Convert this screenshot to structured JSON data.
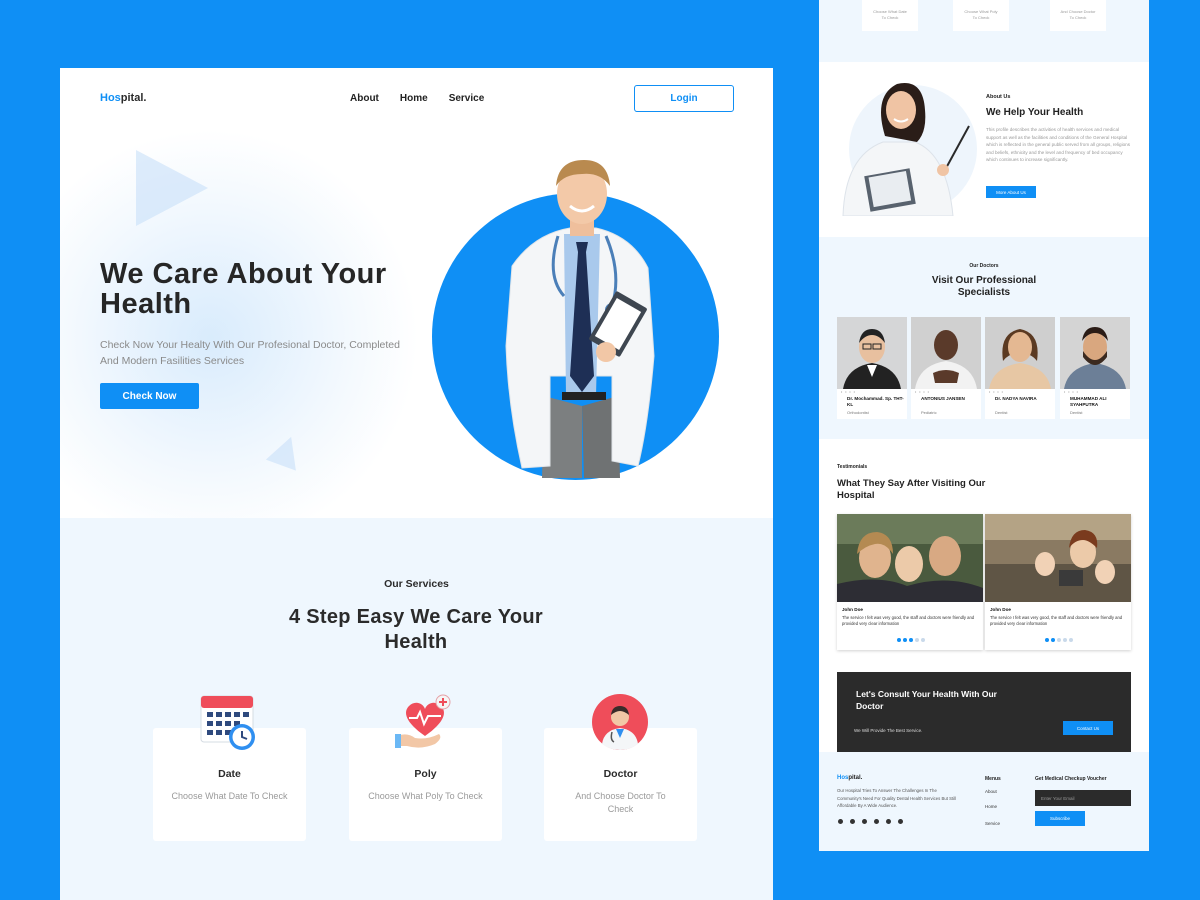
{
  "main": {
    "logo": {
      "prefix": "Hos",
      "suffix": "pital."
    },
    "nav": {
      "about": "About",
      "home": "Home",
      "service": "Service",
      "login": "Login"
    },
    "hero": {
      "title": "We Care About Your Health",
      "subtitle": "Check Now Your Healty With Our Profesional Doctor, Completed And Modern Fasilities Services",
      "button": "Check Now"
    },
    "services": {
      "kicker": "Our Services",
      "title": "4 Step Easy We Care Your Health",
      "cards": [
        {
          "title": "Date",
          "text": "Choose What Date To Check",
          "icon": "calendar-clock-icon"
        },
        {
          "title": "Poly",
          "text": "Choose What Poly To Check",
          "icon": "heart-hand-icon"
        },
        {
          "title": "Doctor",
          "text": "And Choose Doctor To Check",
          "icon": "doctor-avatar-icon"
        }
      ]
    }
  },
  "side": {
    "top_cards": [
      {
        "line1": "Choose What Date",
        "line2": "To Check"
      },
      {
        "line1": "Choose What Poly",
        "line2": "To Check"
      },
      {
        "line1": "And Choose Doctor",
        "line2": "To Check"
      }
    ],
    "about": {
      "kicker": "About Us",
      "title": "We Help Your Health",
      "text": "This profile describes the activities of health services and medical support as well as the facilities and conditions of the General Hospital which is reflected in the general public served from all groups, religions and beliefs, ethnicity and the level and frequency of bed occupancy which continues to increase significantly.",
      "button": "More About Us"
    },
    "specialists": {
      "kicker": "Our Doctors",
      "title": "Visit Our Professional Specialists",
      "doctors": [
        {
          "name": "Dr. Mochammad. Sp. THT-KL",
          "role": "Orthodontist"
        },
        {
          "name": "ANTONIUS JANSEN",
          "role": "Pediatric"
        },
        {
          "name": "Dr. NADYA NAVIRA",
          "role": "Dentist"
        },
        {
          "name": "MUHAMMAD ALI SYAHPUTRA",
          "role": "Dentist"
        }
      ]
    },
    "testimonials": {
      "kicker": "Testimonials",
      "title": "What They Say After Visiting Our Hospital",
      "items": [
        {
          "name": "John Doe",
          "text": "The service I felt was very good, the staff and doctors were friendly and provided very clear information",
          "rating": 3
        },
        {
          "name": "John Doe",
          "text": "The service I felt was very good, the staff and doctors were friendly and provided very clear information",
          "rating": 2
        }
      ]
    },
    "cta": {
      "title": "Let's Consult Your Health With Our Doctor",
      "subtitle": "We Will Provide The Best Service.",
      "button": "Contact Us"
    },
    "footer": {
      "logo_prefix": "Hos",
      "logo_suffix": "pital.",
      "text": "Our Hospital Tries To Answer The Challenges In The Community's Need For Quality Dental Health Services But Still Affordable By A Wide Audience.",
      "menus_title": "Menus",
      "menus": [
        "About",
        "Home",
        "Service"
      ],
      "voucher_title": "Get Medical Checkup Voucher",
      "email_placeholder": "Enter Your Email",
      "subscribe": "Subscribe"
    }
  },
  "colors": {
    "accent": "#0f8ff5",
    "background": "#0f8ff5",
    "section_tint": "#eff7fe",
    "dark": "#2b2b2b"
  }
}
